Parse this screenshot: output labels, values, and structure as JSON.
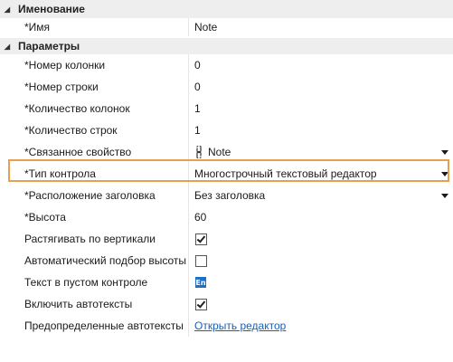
{
  "sections": {
    "naming": {
      "title": "Именование",
      "rows": {
        "name": {
          "label": "*Имя",
          "value": "Note"
        }
      }
    },
    "parameters": {
      "title": "Параметры",
      "rows": {
        "column_number": {
          "label": "*Номер колонки",
          "value": "0"
        },
        "row_number": {
          "label": "*Номер строки",
          "value": "0"
        },
        "column_count": {
          "label": "*Количество колонок",
          "value": "1"
        },
        "row_count": {
          "label": "*Количество строк",
          "value": "1"
        },
        "bound_property": {
          "label": "*Связанное свойство",
          "value": "Note",
          "icon": "link-icon"
        },
        "control_type": {
          "label": "*Тип контрола",
          "value": "Многострочный текстовый редактор",
          "highlighted": true
        },
        "title_position": {
          "label": "*Расположение заголовка",
          "value": "Без заголовка"
        },
        "height": {
          "label": "*Высота",
          "value": "60"
        },
        "stretch_vertical": {
          "label": "Растягивать по вертикали",
          "checked": true
        },
        "auto_height": {
          "label": "Автоматический подбор высоты",
          "checked": false
        },
        "empty_text": {
          "label": "Текст в пустом контроле",
          "icon_text": "En"
        },
        "enable_autotexts": {
          "label": "Включить автотексты",
          "checked": true
        },
        "predefined_autotexts": {
          "label": "Предопределенные автотексты",
          "link": "Открыть редактор"
        }
      }
    }
  },
  "colors": {
    "highlight_border": "#e8a04e",
    "section_bg": "#eeeeee",
    "link": "#1a5fb4",
    "lang_icon_bg": "#1e6fc8"
  }
}
